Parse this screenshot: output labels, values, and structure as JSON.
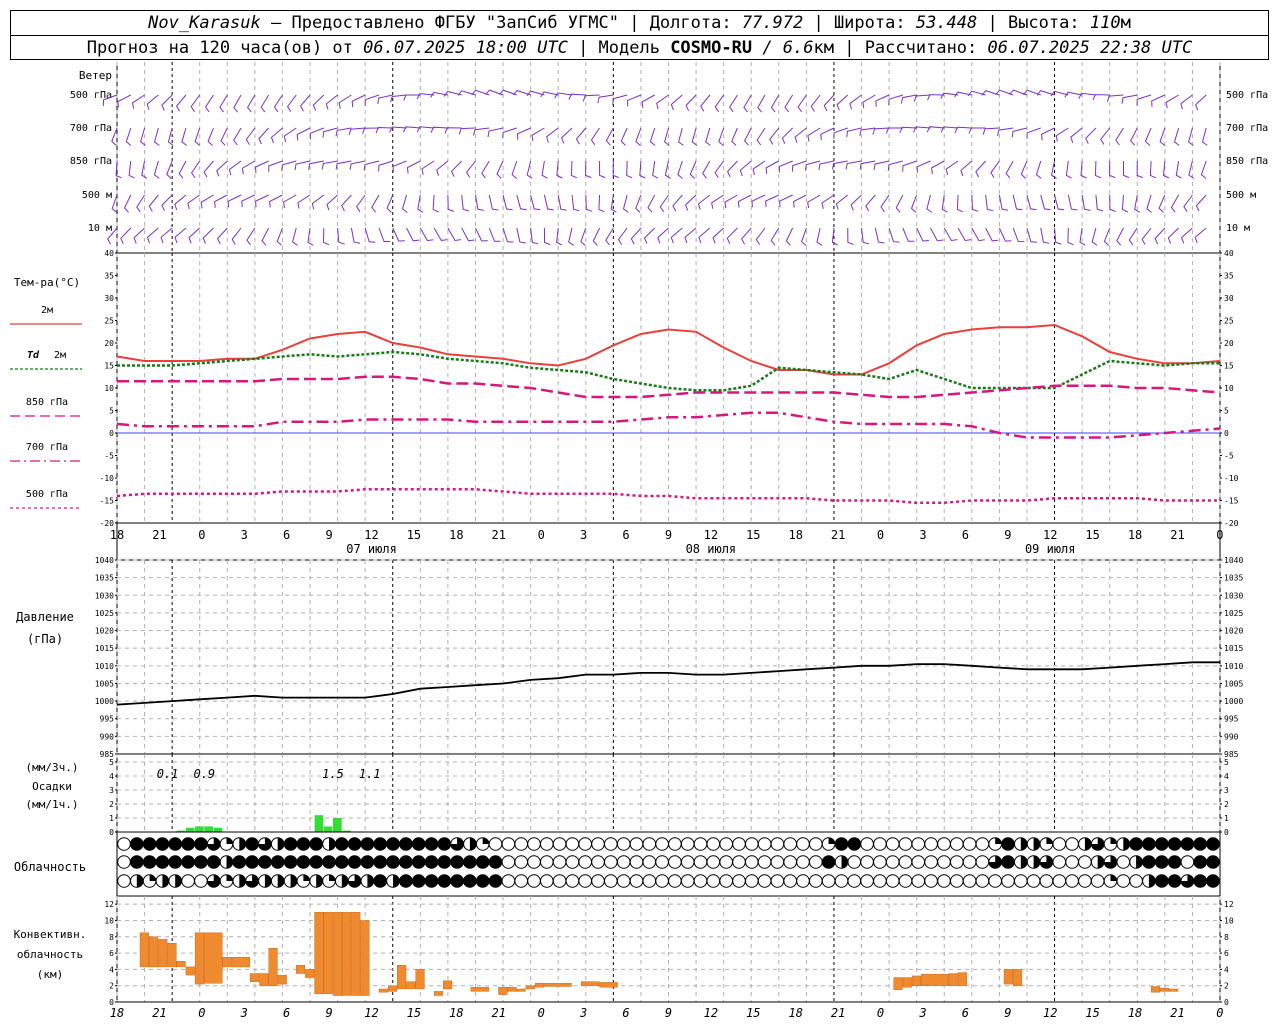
{
  "header": {
    "station": "Nov_Karasuk",
    "sep1": " – Предоставлено ФГБУ \"ЗапСиб УГМС\" | Долгота: ",
    "lon": "77.972",
    "sep2": " | Широта: ",
    "lat": "53.448",
    "sep3": " | Высота: ",
    "alt": "110",
    "alt_unit": "м",
    "forecast_prefix": "Прогноз на 120 часа(ов) от ",
    "forecast_time": "06.07.2025 18:00 UTC",
    "model_prefix": " | Модель ",
    "model": "COSMO-RU",
    "model_res": " / 6.6",
    "model_res_unit": "км",
    "calc_prefix": " | Рассчитано: ",
    "calc_time": "06.07.2025 22:38 UTC"
  },
  "colors": {
    "wind": "#7b2fc8",
    "t2m": "#e8403a",
    "td2m": "#1a7a1a",
    "t850": "#d6177e",
    "t700": "#d6177e",
    "t500": "#d6177e",
    "pressure": "#000000",
    "precip": "#33dd33",
    "convective": "#ef8a2e",
    "zero_line": "#4040ff"
  },
  "chart_data": [
    {
      "type": "wind_barbs",
      "title": "Ветер",
      "levels": [
        "500 гПа",
        "700 гПа",
        "850 гПа",
        "500 м",
        "10  м"
      ]
    },
    {
      "type": "line",
      "title": "Тем-ра(°С)",
      "ylim": [
        -20,
        40
      ],
      "yticks": [
        -20,
        -15,
        -10,
        -5,
        0,
        5,
        10,
        15,
        20,
        25,
        30,
        35,
        40
      ],
      "x_hour_labels": [
        "18",
        "21",
        "0",
        "3",
        "6",
        "9",
        "12",
        "15",
        "18",
        "21",
        "0",
        "3",
        "6",
        "9",
        "12",
        "15",
        "18",
        "21",
        "0",
        "3",
        "6",
        "9",
        "12",
        "15",
        "18",
        "21",
        "0"
      ],
      "date_labels": [
        {
          "index": 6,
          "label": "07 июля"
        },
        {
          "index": 14,
          "label": "08 июля"
        },
        {
          "index": 22,
          "label": "09 июля"
        }
      ],
      "x_hours": [
        0,
        3,
        6,
        9,
        12,
        15,
        18,
        21,
        24,
        27,
        30,
        33,
        36,
        39,
        42,
        45,
        48,
        51,
        54,
        57,
        60,
        63,
        66,
        69,
        72,
        75,
        78,
        81,
        84,
        87,
        90,
        93,
        96,
        99,
        102,
        105,
        108,
        111,
        114,
        117,
        120
      ],
      "series": [
        {
          "name": "2м",
          "values": [
            17,
            16,
            16,
            16,
            16.5,
            16.5,
            18.5,
            21,
            22,
            22.5,
            20,
            19,
            17.5,
            17,
            16.5,
            15.5,
            15,
            16.5,
            19.5,
            22,
            23,
            22.5,
            19,
            16,
            14,
            14,
            13,
            13,
            15.5,
            19.5,
            22,
            23,
            23.5,
            23.5,
            24,
            21.5,
            18,
            16.5,
            15.5,
            15.5,
            16
          ]
        },
        {
          "name": "2м",
          "label_prefix": "Td",
          "values": [
            15,
            15,
            15,
            15.5,
            16,
            16.5,
            17,
            17.5,
            17,
            17.5,
            18,
            17.5,
            16.5,
            16,
            15.5,
            14.5,
            14,
            13.5,
            12,
            11,
            10,
            9.5,
            9.5,
            10.5,
            14.5,
            14,
            13.5,
            13,
            12,
            14,
            12,
            10,
            10,
            10,
            10,
            13,
            16,
            15.5,
            15,
            15.5,
            15.5
          ]
        },
        {
          "name": "850 гПа",
          "values": [
            11.5,
            11.5,
            11.5,
            11.5,
            11.5,
            11.5,
            12,
            12,
            12,
            12.5,
            12.5,
            12,
            11,
            11,
            10.5,
            10,
            9,
            8,
            8,
            8,
            8.5,
            9,
            9,
            9,
            9,
            9,
            9,
            8.5,
            8,
            8,
            8.5,
            9,
            9.5,
            10,
            10.5,
            10.5,
            10.5,
            10,
            10,
            9.5,
            9
          ]
        },
        {
          "name": "700 гПа",
          "values": [
            2,
            1.5,
            1.5,
            1.5,
            1.5,
            1.5,
            2.5,
            2.5,
            2.5,
            3,
            3,
            3,
            3,
            2.5,
            2.5,
            2.5,
            2.5,
            2.5,
            2.5,
            3,
            3.5,
            3.5,
            4,
            4.5,
            4.5,
            3.5,
            2.5,
            2,
            2,
            2,
            2,
            1.5,
            0,
            -1,
            -1,
            -1,
            -1,
            -0.5,
            0,
            0.5,
            1
          ]
        },
        {
          "name": "500 гПа",
          "values": [
            -14,
            -13.5,
            -13.5,
            -13.5,
            -13.5,
            -13.5,
            -13,
            -13,
            -13,
            -12.5,
            -12.5,
            -12.5,
            -12.5,
            -12.5,
            -13,
            -13.5,
            -13.5,
            -13.5,
            -13.5,
            -14,
            -14,
            -14.5,
            -14.5,
            -14.5,
            -14.5,
            -14.5,
            -15,
            -15,
            -15,
            -15.5,
            -15.5,
            -15,
            -15,
            -15,
            -14.5,
            -14.5,
            -14.5,
            -14.5,
            -15,
            -15,
            -15
          ]
        }
      ]
    },
    {
      "type": "line",
      "title": "Давление",
      "ylabel": "(гПа)",
      "ylim": [
        985,
        1040
      ],
      "yticks": [
        985,
        990,
        995,
        1000,
        1005,
        1010,
        1015,
        1020,
        1025,
        1030,
        1035,
        1040
      ],
      "x_hours": [
        0,
        3,
        6,
        9,
        12,
        15,
        18,
        21,
        24,
        27,
        30,
        33,
        36,
        39,
        42,
        45,
        48,
        51,
        54,
        57,
        60,
        63,
        66,
        69,
        72,
        75,
        78,
        81,
        84,
        87,
        90,
        93,
        96,
        99,
        102,
        105,
        108,
        111,
        114,
        117,
        120
      ],
      "series": [
        {
          "name": "",
          "values": [
            999,
            999.5,
            1000,
            1000.5,
            1001,
            1001.5,
            1001,
            1001,
            1001,
            1001,
            1002,
            1003.5,
            1004,
            1004.5,
            1005,
            1006,
            1006.5,
            1007.5,
            1007.5,
            1008,
            1008,
            1007.5,
            1007.5,
            1008,
            1008.5,
            1009,
            1009.5,
            1010,
            1010,
            1010.5,
            1010.5,
            1010,
            1009.5,
            1009,
            1009,
            1009,
            1009.5,
            1010,
            1010.5,
            1011,
            1011
          ]
        }
      ]
    },
    {
      "type": "bar",
      "title": "Осадки",
      "ylabel_top": "(мм/3ч.)",
      "ylabel_bottom": "(мм/1ч.)",
      "ylim": [
        0,
        5
      ],
      "yticks": [
        0,
        1,
        2,
        3,
        4,
        5
      ],
      "period_totals": [
        {
          "hour": 5.5,
          "value": "0.1"
        },
        {
          "hour": 9.5,
          "value": "0.9"
        },
        {
          "hour": 23.5,
          "value": "1.5"
        },
        {
          "hour": 27.5,
          "value": "1.1"
        }
      ],
      "hourly": [
        {
          "hour": 7,
          "value": 0.1
        },
        {
          "hour": 8,
          "value": 0.3
        },
        {
          "hour": 9,
          "value": 0.4
        },
        {
          "hour": 10,
          "value": 0.4
        },
        {
          "hour": 11,
          "value": 0.3
        },
        {
          "hour": 22,
          "value": 1.2
        },
        {
          "hour": 23,
          "value": 0.4
        },
        {
          "hour": 24,
          "value": 1.0
        },
        {
          "hour": 25,
          "value": 0.1
        }
      ]
    },
    {
      "type": "cloud_symbols",
      "title": "Облачность",
      "rows": 3,
      "cover_by_hour": [
        "0 4 4 4 4 4 4 3 1 2 4 3 2 4 4 4 2 4 4 4 4 4 4 4 4 4 3 2 1 0 0 0 0 0 0 0 0 0 0 0 0 0 0 0 0 0 0 0 0 0 0 0 0 0 0 1 4 4 0 0 0 0 0 0 0 0 0 0 1 4 2 2 1 0 0 2 3 1 2 4 4 4 4 4 4 4",
        "0 4 4 4 4 4 4 4 2 4 4 4 4 4 4 4 4 4 4 4 4 4 4 4 4 4 4 4 4 4 0 0 0 0 0 0 0 0 0 0 0 0 0 0 0 0 0 0 0 0 0 0 0 0 0 4 2 0 0 0 0 0 0 0 0 0 0 0 3 4 2 2 3 0 0 0 2 3 0 2 4 4 4 0 4 4",
        "0 2 1 2 2 0 0 3 1 2 3 2 2 2 1 2 1 2 3 2 4 2 4 4 4 4 4 4 4 4 0 0 0 0 0 0 0 0 0 0 0 0 0 0 0 0 0 0 0 0 0 0 0 0 0 0 0 0 0 0 0 0 0 0 0 0 0 0 0 0 0 0 0 0 0 0 0 1 0 0 2 4 4 3 4 4"
      ]
    },
    {
      "type": "range_bar",
      "title": "Конвективн.",
      "title2": "облачность",
      "ylabel": "(км)",
      "ylim": [
        0,
        13
      ],
      "yticks": [
        0,
        2,
        4,
        6,
        8,
        10,
        12
      ],
      "bars": [
        {
          "from": 2.5,
          "to": 3.5,
          "base": 4.3,
          "top": 8.5
        },
        {
          "from": 3.5,
          "to": 4.5,
          "base": 4.3,
          "top": 8
        },
        {
          "from": 4.5,
          "to": 5.5,
          "base": 4.3,
          "top": 7.7
        },
        {
          "from": 5.5,
          "to": 6.5,
          "base": 4.3,
          "top": 7.2
        },
        {
          "from": 6.5,
          "to": 7.5,
          "base": 4.3,
          "top": 5
        },
        {
          "from": 7.5,
          "to": 8.5,
          "base": 3.3,
          "top": 4.3
        },
        {
          "from": 8.5,
          "to": 9.5,
          "base": 2.2,
          "top": 8.5
        },
        {
          "from": 9.5,
          "to": 11.5,
          "base": 2.3,
          "top": 8.5
        },
        {
          "from": 11.5,
          "to": 12.5,
          "base": 4.3,
          "top": 5.5
        },
        {
          "from": 12.5,
          "to": 14.5,
          "base": 4.3,
          "top": 5.5
        },
        {
          "from": 14.5,
          "to": 15.5,
          "base": 2.5,
          "top": 3.5
        },
        {
          "from": 15.5,
          "to": 16.5,
          "base": 2,
          "top": 3.5
        },
        {
          "from": 16.5,
          "to": 17.5,
          "base": 2,
          "top": 6.6
        },
        {
          "from": 17.5,
          "to": 18.5,
          "base": 2.2,
          "top": 3.3
        },
        {
          "from": 19.5,
          "to": 20.5,
          "base": 3.5,
          "top": 4.5
        },
        {
          "from": 20.5,
          "to": 21.5,
          "base": 3,
          "top": 4
        },
        {
          "from": 21.5,
          "to": 22.5,
          "base": 1,
          "top": 11
        },
        {
          "from": 22.5,
          "to": 23.5,
          "base": 1,
          "top": 11
        },
        {
          "from": 23.5,
          "to": 24.5,
          "base": 0.8,
          "top": 11
        },
        {
          "from": 24.5,
          "to": 25.5,
          "base": 0.8,
          "top": 11
        },
        {
          "from": 25.5,
          "to": 26.5,
          "base": 0.8,
          "top": 11
        },
        {
          "from": 26.5,
          "to": 27.5,
          "base": 0.8,
          "top": 10
        },
        {
          "from": 28.5,
          "to": 29.5,
          "base": 1.2,
          "top": 1.6
        },
        {
          "from": 29.5,
          "to": 30.5,
          "base": 1.3,
          "top": 2
        },
        {
          "from": 30.5,
          "to": 31.5,
          "base": 1.6,
          "top": 4.5
        },
        {
          "from": 31.5,
          "to": 32.5,
          "base": 1.6,
          "top": 2.5
        },
        {
          "from": 32.5,
          "to": 33.5,
          "base": 1.6,
          "top": 4
        },
        {
          "from": 34.5,
          "to": 35.5,
          "base": 0.8,
          "top": 1.3
        },
        {
          "from": 35.5,
          "to": 36.5,
          "base": 1.6,
          "top": 2.6
        },
        {
          "from": 38.5,
          "to": 40.5,
          "base": 1.3,
          "top": 1.8
        },
        {
          "from": 41.5,
          "to": 42.5,
          "base": 0.9,
          "top": 1.8
        },
        {
          "from": 42.5,
          "to": 43.5,
          "base": 1.3,
          "top": 1.8
        },
        {
          "from": 43.5,
          "to": 44.5,
          "base": 1.3,
          "top": 1.6
        },
        {
          "from": 44.5,
          "to": 45.5,
          "base": 1.6,
          "top": 2
        },
        {
          "from": 45.5,
          "to": 46.5,
          "base": 1.8,
          "top": 2.3
        },
        {
          "from": 46.5,
          "to": 49.5,
          "base": 1.9,
          "top": 2.3
        },
        {
          "from": 50.5,
          "to": 52.5,
          "base": 2,
          "top": 2.5
        },
        {
          "from": 52.5,
          "to": 54.5,
          "base": 1.8,
          "top": 2.4
        },
        {
          "from": 84.5,
          "to": 85.5,
          "base": 1.5,
          "top": 3
        },
        {
          "from": 85.5,
          "to": 86.5,
          "base": 1.8,
          "top": 3
        },
        {
          "from": 86.5,
          "to": 87.5,
          "base": 2,
          "top": 3.2
        },
        {
          "from": 87.5,
          "to": 90.5,
          "base": 2,
          "top": 3.4
        },
        {
          "from": 90.5,
          "to": 91.5,
          "base": 2,
          "top": 3.5
        },
        {
          "from": 91.5,
          "to": 92.5,
          "base": 2,
          "top": 3.6
        },
        {
          "from": 96.5,
          "to": 97.5,
          "base": 2.2,
          "top": 4
        },
        {
          "from": 97.5,
          "to": 98.5,
          "base": 2,
          "top": 4
        },
        {
          "from": 112.5,
          "to": 113.5,
          "base": 1.2,
          "top": 1.9
        },
        {
          "from": 113.5,
          "to": 114.5,
          "base": 1.3,
          "top": 1.7
        },
        {
          "from": 114.5,
          "to": 115.5,
          "base": 1.3,
          "top": 1.6
        }
      ]
    }
  ]
}
